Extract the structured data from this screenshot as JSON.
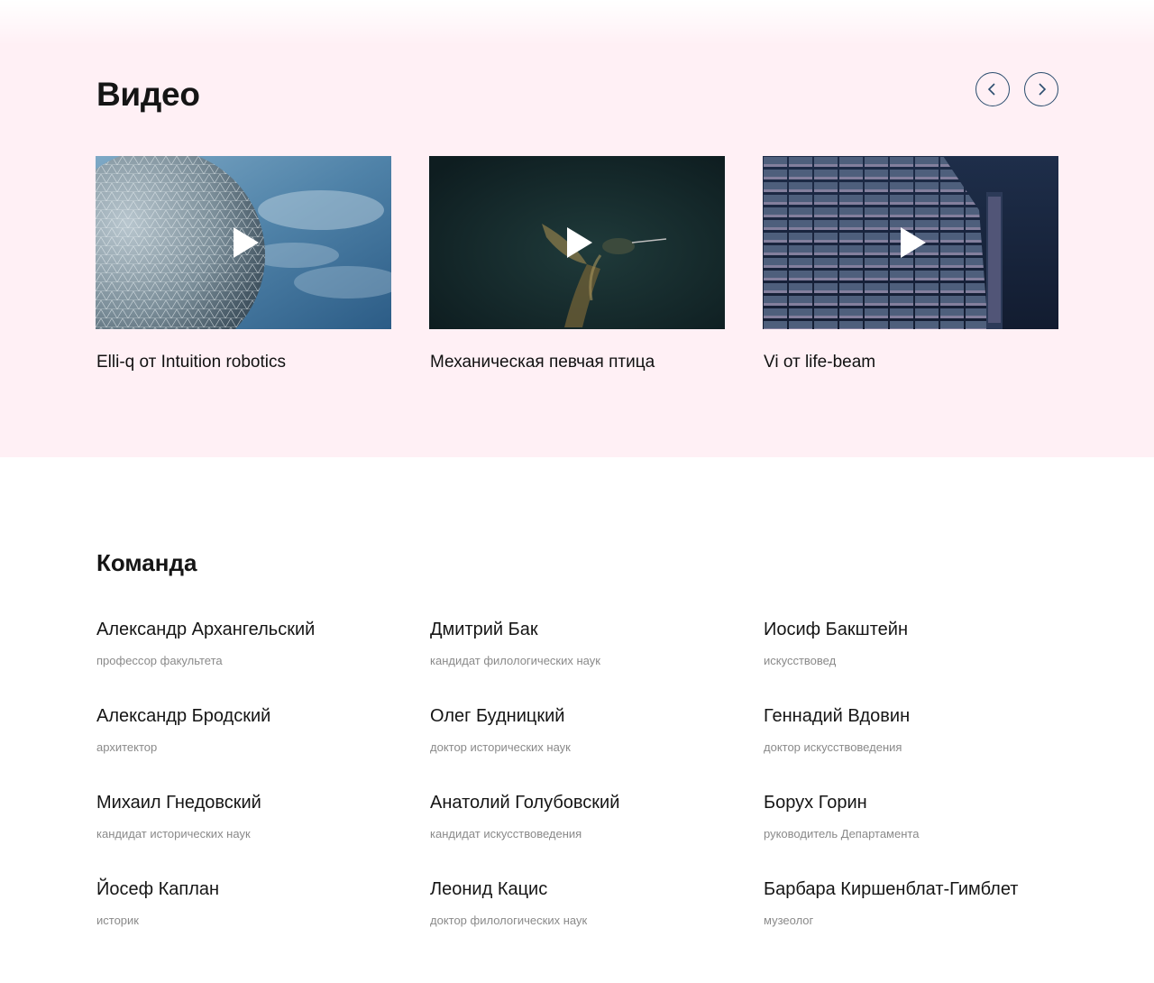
{
  "videos": {
    "title": "Видео",
    "prev_icon": "chevron-left-icon",
    "next_icon": "chevron-right-icon",
    "items": [
      {
        "caption": "Elli-q от Intuition robotics",
        "thumb": "geodesic-sphere-sky"
      },
      {
        "caption": "Механическая певчая птица",
        "thumb": "hummingbird-dark"
      },
      {
        "caption": "Vi от life-beam",
        "thumb": "building-facade"
      }
    ]
  },
  "team": {
    "title": "Команда",
    "members": [
      {
        "name": "Александр Архангельский",
        "role": "профессор факультета"
      },
      {
        "name": "Дмитрий Бак",
        "role": "кандидат филологических наук"
      },
      {
        "name": "Иосиф Бакштейн",
        "role": "искусствовед"
      },
      {
        "name": "Александр Бродский",
        "role": "архитектор"
      },
      {
        "name": "Олег Будницкий",
        "role": "доктор исторических наук"
      },
      {
        "name": "Геннадий Вдовин",
        "role": "доктор искусствоведения"
      },
      {
        "name": "Михаил Гнедовский",
        "role": "кандидат исторических наук"
      },
      {
        "name": "Анатолий Голубовский",
        "role": "кандидат искусствоведения"
      },
      {
        "name": "Борух Горин",
        "role": "руководитель Департамента"
      },
      {
        "name": "Йосеф Каплан",
        "role": "историк"
      },
      {
        "name": "Леонид Кацис",
        "role": "доктор филологических наук"
      },
      {
        "name": "Барбара Киршенблат-Гимблет",
        "role": "музеолог"
      }
    ]
  },
  "colors": {
    "section_bg": "#fff0f5",
    "nav_border": "#2b4d6e",
    "role_text": "#8a8a8a"
  }
}
